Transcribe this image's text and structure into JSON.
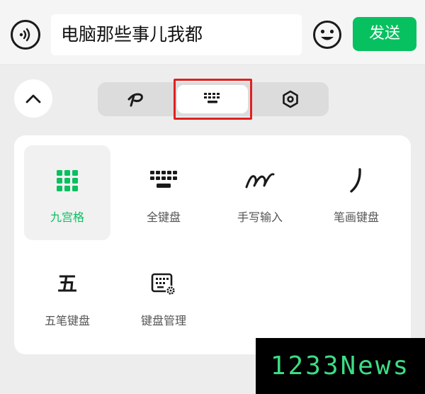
{
  "input_bar": {
    "message_text": "电脑那些事儿我都",
    "send_label": "发送"
  },
  "toolbar": {
    "segments": [
      {
        "icon": "handwriting-p-icon",
        "selected": false
      },
      {
        "icon": "keyboard-icon",
        "selected": true
      },
      {
        "icon": "hexagon-settings-icon",
        "selected": false
      }
    ],
    "highlight_color": "#e02020"
  },
  "keyboard_panel": {
    "tiles": [
      {
        "label": "九宫格",
        "icon": "nine-grid-icon",
        "selected": true
      },
      {
        "label": "全键盘",
        "icon": "full-keyboard-icon",
        "selected": false
      },
      {
        "label": "手写输入",
        "icon": "handwriting-icon",
        "selected": false
      },
      {
        "label": "笔画键盘",
        "icon": "stroke-icon",
        "selected": false
      },
      {
        "label": "五笔键盘",
        "icon": "wubi-icon",
        "glyph": "五",
        "selected": false
      },
      {
        "label": "键盘管理",
        "icon": "keyboard-manage-icon",
        "selected": false
      }
    ]
  },
  "colors": {
    "accent": "#07c160",
    "background": "#ededed"
  },
  "watermark": "1233News"
}
